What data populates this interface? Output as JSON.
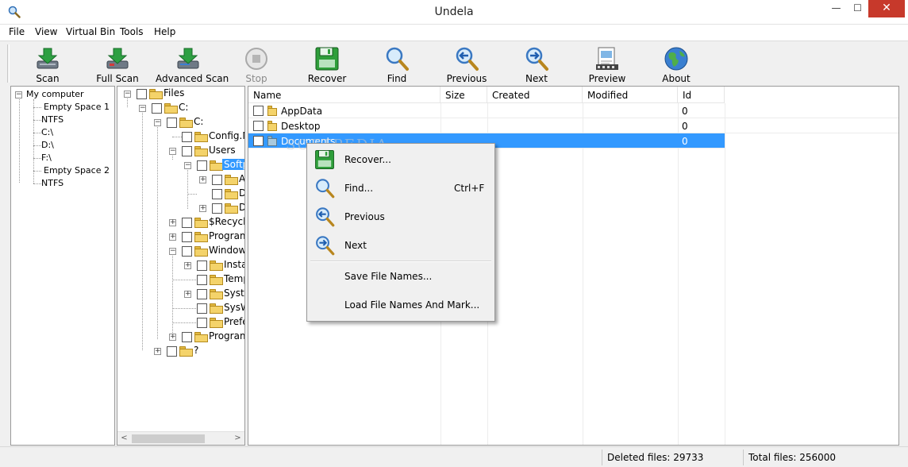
{
  "window": {
    "title": "Undela",
    "min_glyph": "—",
    "max_glyph": "☐",
    "close_glyph": "✕"
  },
  "menu": [
    "File",
    "View",
    "Virtual Bin",
    "Tools",
    "Help"
  ],
  "toolbar": [
    {
      "label": "Scan",
      "icon": "scan-icon",
      "enabled": true
    },
    {
      "label": "Full Scan",
      "icon": "full-scan-icon",
      "enabled": true
    },
    {
      "label": "Advanced Scan",
      "icon": "advanced-scan-icon",
      "enabled": true
    },
    {
      "label": "Stop",
      "icon": "stop-icon",
      "enabled": false
    },
    {
      "label": "Recover",
      "icon": "floppy-icon",
      "enabled": true
    },
    {
      "label": "Find",
      "icon": "magnifier-icon",
      "enabled": true
    },
    {
      "label": "Previous",
      "icon": "previous-icon",
      "enabled": true
    },
    {
      "label": "Next",
      "icon": "next-icon",
      "enabled": true
    },
    {
      "label": "Preview",
      "icon": "preview-icon",
      "enabled": true
    },
    {
      "label": "About",
      "icon": "globe-icon",
      "enabled": true
    }
  ],
  "drives": {
    "root": "My computer",
    "items": [
      "Empty Space 1",
      "NTFS",
      "C:\\",
      "D:\\",
      "F:\\",
      "Empty Space 2",
      "NTFS"
    ]
  },
  "tree": {
    "nodes": [
      "Files",
      "C:",
      "C:",
      "Config.M",
      "Users",
      "Softp",
      "A",
      "D",
      "D",
      "$Recycle",
      "Program",
      "Window",
      "Insta",
      "Temp",
      "Syste",
      "SysW",
      "Prefe",
      "Program",
      "?"
    ],
    "scroll_left": "<",
    "scroll_right": ">"
  },
  "list": {
    "columns": [
      "Name",
      "Size",
      "Created",
      "Modified",
      "Id"
    ],
    "rows": [
      {
        "name": "AppData",
        "size": "",
        "created": "",
        "modified": "",
        "id": "0"
      },
      {
        "name": "Desktop",
        "size": "",
        "created": "",
        "modified": "",
        "id": "0"
      },
      {
        "name": "Documents",
        "size": "",
        "created": "",
        "modified": "",
        "id": "0"
      }
    ]
  },
  "context_menu": {
    "items": [
      {
        "label": "Recover...",
        "shortcut": "",
        "icon": "floppy-icon"
      },
      {
        "label": "Find...",
        "shortcut": "Ctrl+F",
        "icon": "magnifier-icon"
      },
      {
        "label": "Previous",
        "shortcut": "",
        "icon": "previous-icon"
      },
      {
        "label": "Next",
        "shortcut": "",
        "icon": "next-icon"
      },
      {
        "label": "Save File Names...",
        "shortcut": "",
        "icon": ""
      },
      {
        "label": "Load File Names And Mark...",
        "shortcut": "",
        "icon": ""
      }
    ]
  },
  "status": {
    "deleted": "Deleted files: 29733",
    "total": "Total files: 256000"
  },
  "watermark": "SOFTPEDIA",
  "colors": {
    "selection": "#3399ff",
    "close_button": "#c7392b",
    "folder": "#f4d36a"
  }
}
